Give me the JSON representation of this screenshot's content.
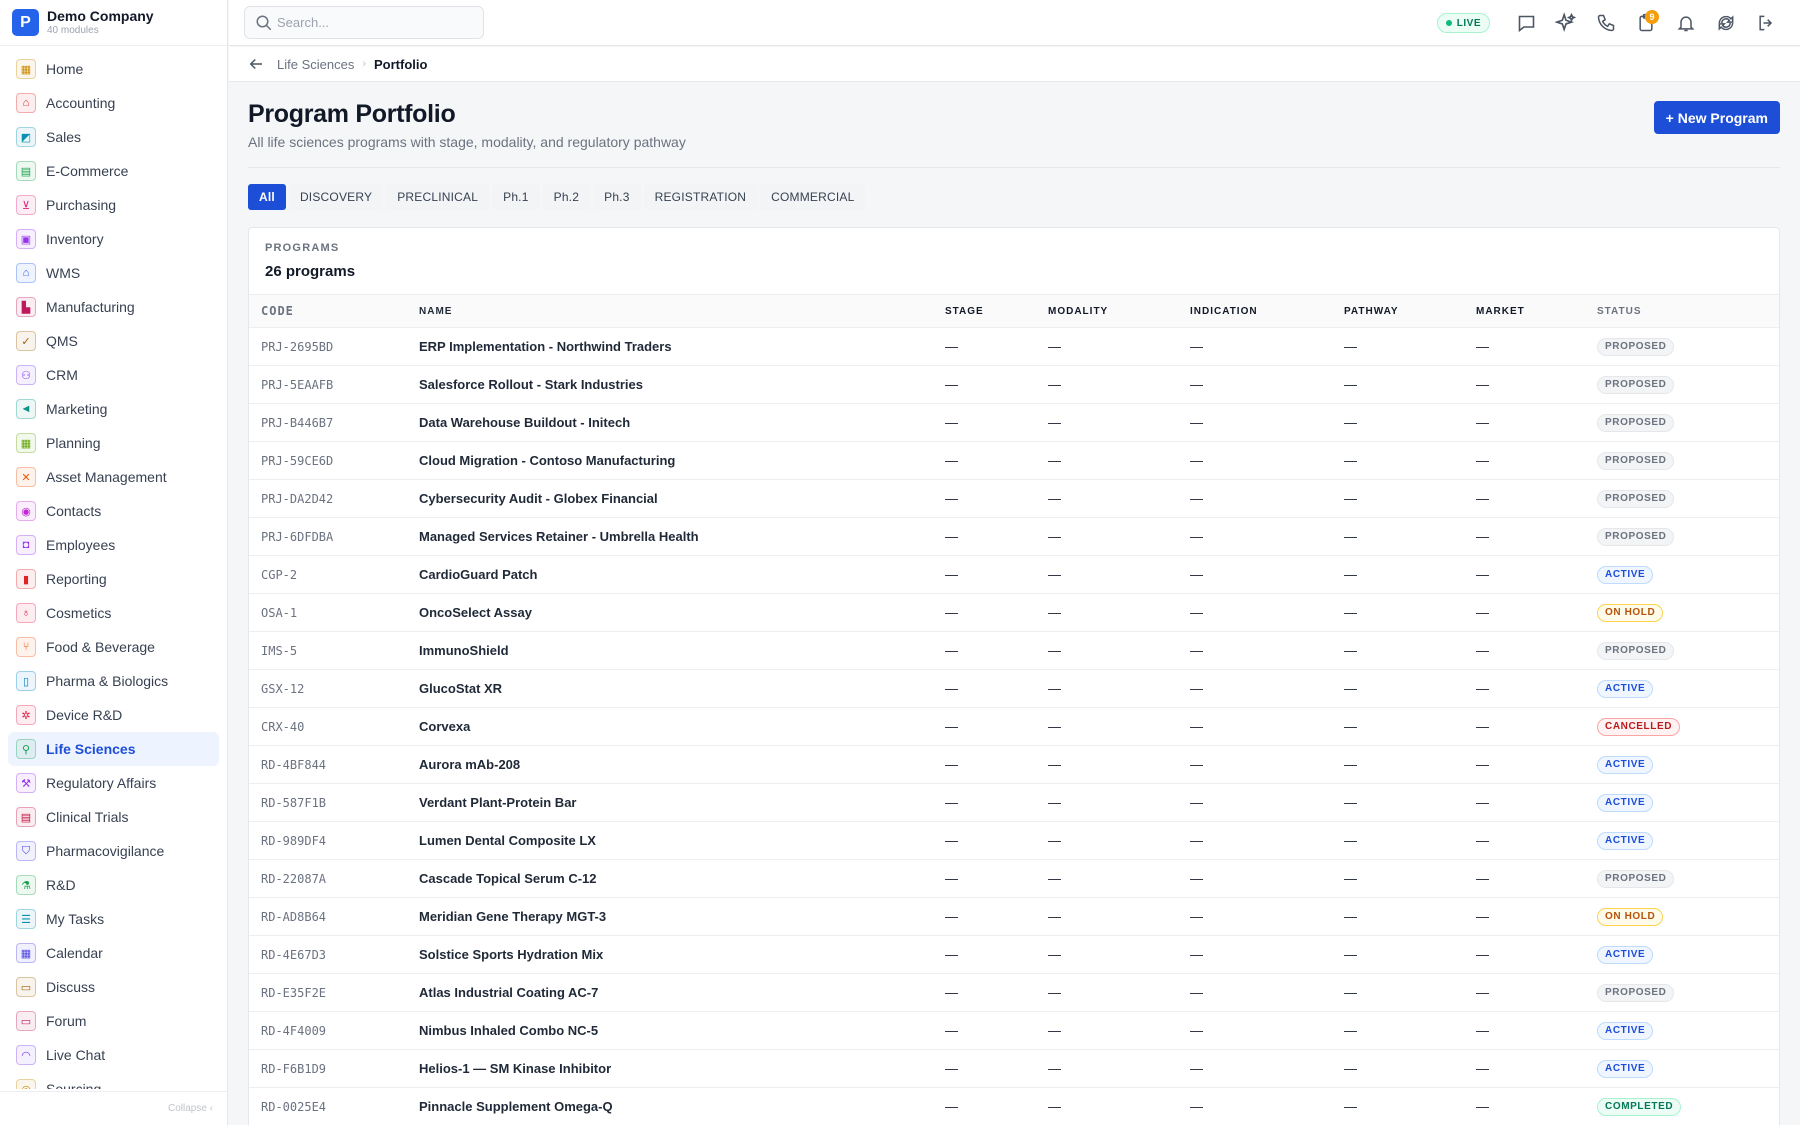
{
  "company": {
    "initial": "P",
    "name": "Demo Company",
    "modules": "40 modules"
  },
  "sidebar": {
    "items": [
      {
        "label": "Home",
        "icon": "home-icon",
        "color": "#ca8a04"
      },
      {
        "label": "Accounting",
        "icon": "bank-icon",
        "color": "#dc2626"
      },
      {
        "label": "Sales",
        "icon": "sales-icon",
        "color": "#0891b2"
      },
      {
        "label": "E-Commerce",
        "icon": "storefront-icon",
        "color": "#16a34a"
      },
      {
        "label": "Purchasing",
        "icon": "cart-icon",
        "color": "#db2777"
      },
      {
        "label": "Inventory",
        "icon": "box-icon",
        "color": "#9333ea"
      },
      {
        "label": "WMS",
        "icon": "warehouse-icon",
        "color": "#2563eb"
      },
      {
        "label": "Manufacturing",
        "icon": "factory-icon",
        "color": "#be185d"
      },
      {
        "label": "QMS",
        "icon": "check-badge-icon",
        "color": "#a16207"
      },
      {
        "label": "CRM",
        "icon": "people-icon",
        "color": "#7c3aed"
      },
      {
        "label": "Marketing",
        "icon": "megaphone-icon",
        "color": "#0d9488"
      },
      {
        "label": "Planning",
        "icon": "calendar-grid-icon",
        "color": "#65a30d"
      },
      {
        "label": "Asset Management",
        "icon": "tools-icon",
        "color": "#ea580c"
      },
      {
        "label": "Contacts",
        "icon": "contact-card-icon",
        "color": "#c026d3"
      },
      {
        "label": "Employees",
        "icon": "employee-icon",
        "color": "#9333ea"
      },
      {
        "label": "Reporting",
        "icon": "bar-chart-icon",
        "color": "#dc2626"
      },
      {
        "label": "Cosmetics",
        "icon": "cosmetics-icon",
        "color": "#e11d48"
      },
      {
        "label": "Food & Beverage",
        "icon": "utensils-icon",
        "color": "#ea580c"
      },
      {
        "label": "Pharma & Biologics",
        "icon": "pill-bottle-icon",
        "color": "#0284c7"
      },
      {
        "label": "Device R&D",
        "icon": "device-icon",
        "color": "#e11d48"
      },
      {
        "label": "Life Sciences",
        "icon": "microscope-icon",
        "color": "#16a34a"
      },
      {
        "label": "Regulatory Affairs",
        "icon": "gavel-icon",
        "color": "#9333ea"
      },
      {
        "label": "Clinical Trials",
        "icon": "clipboard-icon",
        "color": "#be123c"
      },
      {
        "label": "Pharmacovigilance",
        "icon": "shield-icon",
        "color": "#4f46e5"
      },
      {
        "label": "R&D",
        "icon": "flask-icon",
        "color": "#16a34a"
      },
      {
        "label": "My Tasks",
        "icon": "checklist-icon",
        "color": "#0891b2"
      },
      {
        "label": "Calendar",
        "icon": "calendar-icon",
        "color": "#4f46e5"
      },
      {
        "label": "Discuss",
        "icon": "chat-icon",
        "color": "#a16207"
      },
      {
        "label": "Forum",
        "icon": "forum-icon",
        "color": "#be185d"
      },
      {
        "label": "Live Chat",
        "icon": "headset-icon",
        "color": "#7c3aed"
      },
      {
        "label": "Sourcing",
        "icon": "sourcing-icon",
        "color": "#ca8a04"
      }
    ],
    "active_index": 20,
    "collapse_label": "Collapse ‹"
  },
  "topbar": {
    "search_placeholder": "Search...",
    "live_label": "LIVE",
    "notification_count": "9",
    "icons": [
      "message-icon",
      "sparkle-icon",
      "phone-icon",
      "clipboard-badge-icon",
      "bell-icon",
      "sync-icon",
      "logout-icon"
    ]
  },
  "breadcrumb": {
    "parent": "Life Sciences",
    "separator": "›",
    "current": "Portfolio"
  },
  "page": {
    "title": "Program Portfolio",
    "subtitle": "All life sciences programs with stage, modality, and regulatory pathway",
    "new_button": "+ New Program"
  },
  "filters": {
    "items": [
      "All",
      "DISCOVERY",
      "PRECLINICAL",
      "Ph.1",
      "Ph.2",
      "Ph.3",
      "REGISTRATION",
      "COMMERCIAL"
    ],
    "active_index": 0
  },
  "table": {
    "eyebrow": "PROGRAMS",
    "count_label": "26 programs",
    "columns": [
      "CODE",
      "NAME",
      "STAGE",
      "MODALITY",
      "INDICATION",
      "PATHWAY",
      "MARKET",
      "STATUS"
    ],
    "rows": [
      {
        "code": "PRJ-2695BD",
        "name": "ERP Implementation - Northwind Traders",
        "stage": "—",
        "modality": "—",
        "indication": "—",
        "pathway": "—",
        "market": "—",
        "status": "PROPOSED"
      },
      {
        "code": "PRJ-5EAAFB",
        "name": "Salesforce Rollout - Stark Industries",
        "stage": "—",
        "modality": "—",
        "indication": "—",
        "pathway": "—",
        "market": "—",
        "status": "PROPOSED"
      },
      {
        "code": "PRJ-B446B7",
        "name": "Data Warehouse Buildout - Initech",
        "stage": "—",
        "modality": "—",
        "indication": "—",
        "pathway": "—",
        "market": "—",
        "status": "PROPOSED"
      },
      {
        "code": "PRJ-59CE6D",
        "name": "Cloud Migration - Contoso Manufacturing",
        "stage": "—",
        "modality": "—",
        "indication": "—",
        "pathway": "—",
        "market": "—",
        "status": "PROPOSED"
      },
      {
        "code": "PRJ-DA2D42",
        "name": "Cybersecurity Audit - Globex Financial",
        "stage": "—",
        "modality": "—",
        "indication": "—",
        "pathway": "—",
        "market": "—",
        "status": "PROPOSED"
      },
      {
        "code": "PRJ-6DFDBA",
        "name": "Managed Services Retainer - Umbrella Health",
        "stage": "—",
        "modality": "—",
        "indication": "—",
        "pathway": "—",
        "market": "—",
        "status": "PROPOSED"
      },
      {
        "code": "CGP-2",
        "name": "CardioGuard Patch",
        "stage": "—",
        "modality": "—",
        "indication": "—",
        "pathway": "—",
        "market": "—",
        "status": "ACTIVE"
      },
      {
        "code": "OSA-1",
        "name": "OncoSelect Assay",
        "stage": "—",
        "modality": "—",
        "indication": "—",
        "pathway": "—",
        "market": "—",
        "status": "ON HOLD"
      },
      {
        "code": "IMS-5",
        "name": "ImmunoShield",
        "stage": "—",
        "modality": "—",
        "indication": "—",
        "pathway": "—",
        "market": "—",
        "status": "PROPOSED"
      },
      {
        "code": "GSX-12",
        "name": "GlucoStat XR",
        "stage": "—",
        "modality": "—",
        "indication": "—",
        "pathway": "—",
        "market": "—",
        "status": "ACTIVE"
      },
      {
        "code": "CRX-40",
        "name": "Corvexa",
        "stage": "—",
        "modality": "—",
        "indication": "—",
        "pathway": "—",
        "market": "—",
        "status": "CANCELLED"
      },
      {
        "code": "RD-4BF844",
        "name": "Aurora mAb-208",
        "stage": "—",
        "modality": "—",
        "indication": "—",
        "pathway": "—",
        "market": "—",
        "status": "ACTIVE"
      },
      {
        "code": "RD-587F1B",
        "name": "Verdant Plant-Protein Bar",
        "stage": "—",
        "modality": "—",
        "indication": "—",
        "pathway": "—",
        "market": "—",
        "status": "ACTIVE"
      },
      {
        "code": "RD-989DF4",
        "name": "Lumen Dental Composite LX",
        "stage": "—",
        "modality": "—",
        "indication": "—",
        "pathway": "—",
        "market": "—",
        "status": "ACTIVE"
      },
      {
        "code": "RD-22087A",
        "name": "Cascade Topical Serum C-12",
        "stage": "—",
        "modality": "—",
        "indication": "—",
        "pathway": "—",
        "market": "—",
        "status": "PROPOSED"
      },
      {
        "code": "RD-AD8B64",
        "name": "Meridian Gene Therapy MGT-3",
        "stage": "—",
        "modality": "—",
        "indication": "—",
        "pathway": "—",
        "market": "—",
        "status": "ON HOLD"
      },
      {
        "code": "RD-4E67D3",
        "name": "Solstice Sports Hydration Mix",
        "stage": "—",
        "modality": "—",
        "indication": "—",
        "pathway": "—",
        "market": "—",
        "status": "ACTIVE"
      },
      {
        "code": "RD-E35F2E",
        "name": "Atlas Industrial Coating AC-7",
        "stage": "—",
        "modality": "—",
        "indication": "—",
        "pathway": "—",
        "market": "—",
        "status": "PROPOSED"
      },
      {
        "code": "RD-4F4009",
        "name": "Nimbus Inhaled Combo NC-5",
        "stage": "—",
        "modality": "—",
        "indication": "—",
        "pathway": "—",
        "market": "—",
        "status": "ACTIVE"
      },
      {
        "code": "RD-F6B1D9",
        "name": "Helios-1 — SM Kinase Inhibitor",
        "stage": "—",
        "modality": "—",
        "indication": "—",
        "pathway": "—",
        "market": "—",
        "status": "ACTIVE"
      },
      {
        "code": "RD-0025E4",
        "name": "Pinnacle Supplement Omega-Q",
        "stage": "—",
        "modality": "—",
        "indication": "—",
        "pathway": "—",
        "market": "—",
        "status": "COMPLETED"
      }
    ]
  }
}
